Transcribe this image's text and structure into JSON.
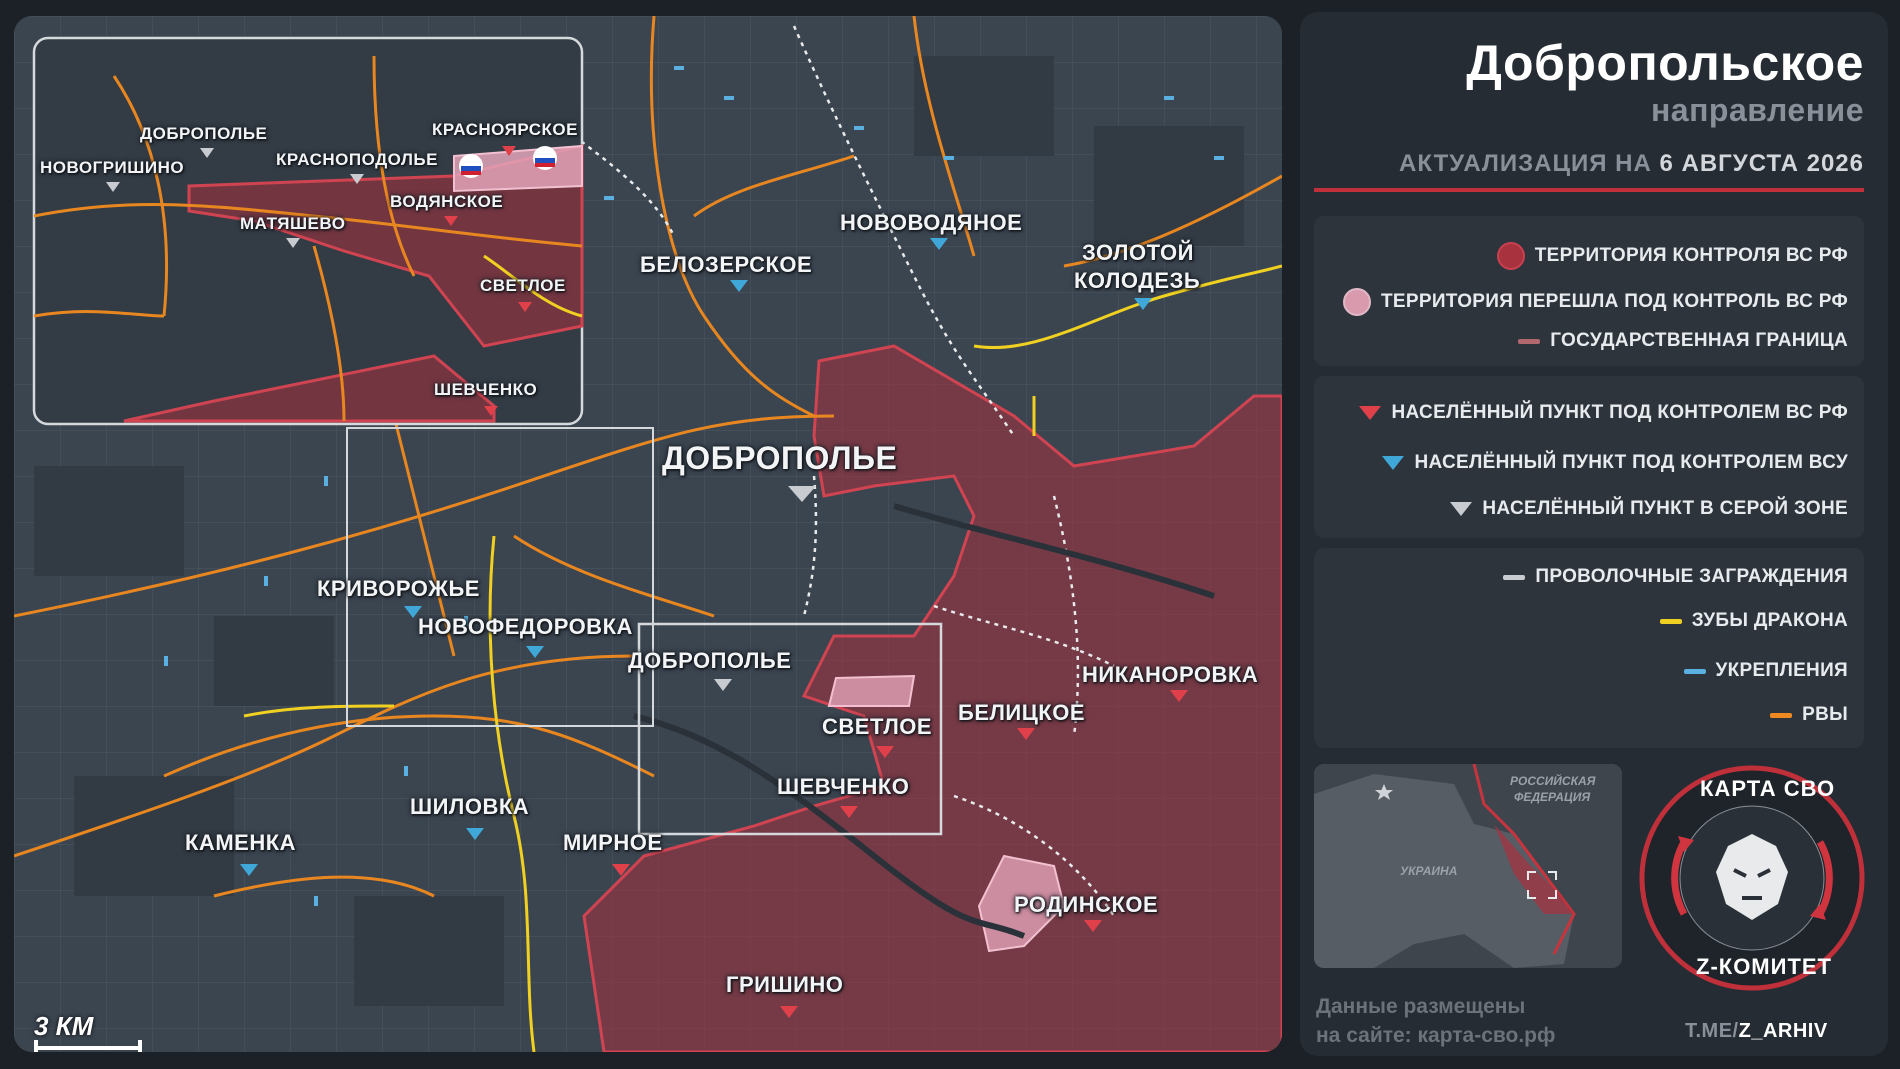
{
  "header": {
    "title": "Добропольское",
    "subtitle": "направление",
    "update_prefix": "АКТУАЛИЗАЦИЯ НА",
    "update_date": "6 АВГУСТА 2026"
  },
  "legend": {
    "group1": [
      {
        "label": "ТЕРРИТОРИЯ КОНТРОЛЯ ВС РФ",
        "color": "#a8323e",
        "shape": "circle"
      },
      {
        "label": "ТЕРРИТОРИЯ ПЕРЕШЛА ПОД КОНТРОЛЬ ВС РФ",
        "color": "#d99aae",
        "shape": "circle"
      },
      {
        "label": "ГОСУДАРСТВЕННАЯ ГРАНИЦА",
        "color": "#b0686e",
        "shape": "line"
      }
    ],
    "group2": [
      {
        "label": "НАСЕЛЁННЫЙ ПУНКТ ПОД КОНТРОЛЕМ ВС РФ",
        "color": "#e0404a",
        "shape": "triangle"
      },
      {
        "label": "НАСЕЛЁННЫЙ ПУНКТ ПОД КОНТРОЛЕМ ВСУ",
        "color": "#3fa8d8",
        "shape": "triangle"
      },
      {
        "label": "НАСЕЛЁННЫЙ ПУНКТ В СЕРОЙ ЗОНЕ",
        "color": "#c8ccd0",
        "shape": "triangle"
      }
    ],
    "group3": [
      {
        "label": "ПРОВОЛОЧНЫЕ ЗАГРАЖДЕНИЯ",
        "color": "#c8ccd0",
        "shape": "line"
      },
      {
        "label": "ЗУБЫ ДРАКОНА",
        "color": "#f0d020",
        "shape": "line"
      },
      {
        "label": "УКРЕПЛЕНИЯ",
        "color": "#5ab0e0",
        "shape": "line"
      },
      {
        "label": "РВЫ",
        "color": "#f08a20",
        "shape": "line"
      }
    ]
  },
  "map": {
    "scale_label": "3 КМ",
    "settlements": [
      {
        "name": "ДОБРОПОЛЬЕ",
        "status": "grey",
        "size": "big"
      },
      {
        "name": "НОВОВОДЯНОЕ",
        "status": "ua",
        "size": "med"
      },
      {
        "name": "БЕЛОЗЕРСКОЕ",
        "status": "ua",
        "size": "med"
      },
      {
        "name": "ЗОЛОТОЙ",
        "status": "ua",
        "size": "med"
      },
      {
        "name": "КОЛОДЕЗЬ",
        "status": "ua",
        "size": "med"
      },
      {
        "name": "КРИВОРОЖЬЕ",
        "status": "ua",
        "size": "med"
      },
      {
        "name": "НОВОФЕДОРОВКА",
        "status": "ua",
        "size": "med"
      },
      {
        "name": "ДОБРОПОЛЬЕ",
        "status": "grey",
        "size": "med"
      },
      {
        "name": "СВЕТЛОЕ",
        "status": "ru",
        "size": "med"
      },
      {
        "name": "ШЕВЧЕНКО",
        "status": "ru",
        "size": "med"
      },
      {
        "name": "БЕЛИЦКОЕ",
        "status": "ru",
        "size": "med"
      },
      {
        "name": "НИКАНОРОВКА",
        "status": "ru",
        "size": "med"
      },
      {
        "name": "ШИЛОВКА",
        "status": "ua",
        "size": "med"
      },
      {
        "name": "КАМЕНКА",
        "status": "ua",
        "size": "med"
      },
      {
        "name": "МИРНОЕ",
        "status": "ru",
        "size": "med"
      },
      {
        "name": "РОДИНСКОЕ",
        "status": "ru",
        "size": "med"
      },
      {
        "name": "ГРИШИНО",
        "status": "ru",
        "size": "med"
      }
    ],
    "inset_settlements": [
      {
        "name": "ДОБРОПОЛЬЕ",
        "status": "grey"
      },
      {
        "name": "НОВОГРИШИНО",
        "status": "grey"
      },
      {
        "name": "КРАСНОПОДОЛЬЕ",
        "status": "grey"
      },
      {
        "name": "КРАСНОЯРСКОЕ",
        "status": "ru"
      },
      {
        "name": "ВОДЯНСКОЕ",
        "status": "ru"
      },
      {
        "name": "МАТЯШЕВО",
        "status": "grey"
      },
      {
        "name": "СВЕТЛОЕ",
        "status": "ru"
      },
      {
        "name": "ШЕВЧЕНКО",
        "status": "ru"
      }
    ]
  },
  "minimap": {
    "label_russia_1": "РОССИЙСКАЯ",
    "label_russia_2": "ФЕДЕРАЦИЯ",
    "label_ukraine": "УКРАИНА"
  },
  "footer": {
    "data_line1": "Данные размещены",
    "data_line2": "на сайте: карта-сво.рф",
    "tg_prefix": "T.ME/",
    "tg_handle": "Z_ARHIV",
    "logo_top": "КАРТА СВО",
    "logo_bottom": "Z-КОМИТЕТ"
  }
}
